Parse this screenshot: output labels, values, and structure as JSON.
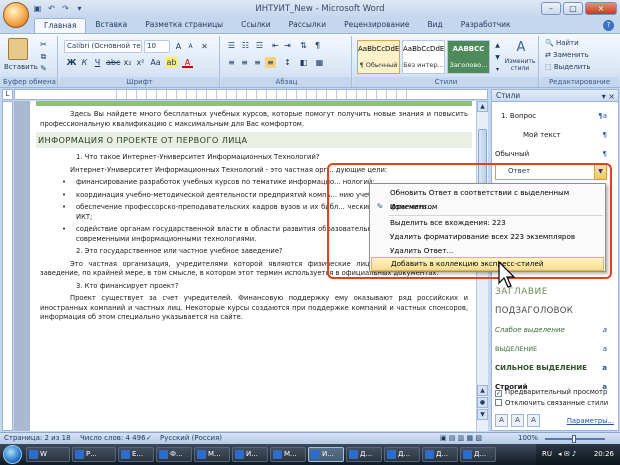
{
  "window": {
    "title": "ИНТУИТ_New - Microsoft Word",
    "controls": [
      "–",
      "□",
      "×"
    ]
  },
  "tabs": [
    "Главная",
    "Вставка",
    "Разметка страницы",
    "Ссылки",
    "Рассылки",
    "Рецензирование",
    "Вид",
    "Разработчик"
  ],
  "ribbon": {
    "clipboard": {
      "label": "Буфер обмена",
      "paste": "Вставить"
    },
    "font": {
      "label": "Шрифт",
      "name": "Calibri (Основной те",
      "size": "10",
      "bold": "Ж",
      "italic": "К",
      "underline": "Ч"
    },
    "paragraph": {
      "label": "Абзац"
    },
    "styles": {
      "label": "Стили",
      "items": [
        {
          "sample": "AaBbCcDdE",
          "name": "¶ Обычный"
        },
        {
          "sample": "AaBbCcDdE",
          "name": "Без интер..."
        },
        {
          "sample": "AABBCC",
          "name": "Заголово..."
        }
      ],
      "change_styles": "Изменить стили"
    },
    "editing": {
      "label": "Редактирование",
      "find": "Найти",
      "replace": "Заменить",
      "select": "Выделить"
    }
  },
  "document": {
    "intro": "Здесь Вы найдете много бесплатных учебных курсов, которые помогут получить новые знания и повысить профессиональную квалификацию  с максимальным для Вас комфортом.",
    "section_heading": "ИНФОРМАЦИЯ О ПРОЕКТЕ ОТ ПЕРВОГО ЛИЦА",
    "q1": "1.       Что такое Интернет-Университет Информационных Технологий?",
    "a1": "Интернет-Университет Информационных Технологий - это частная орг... дующие цели:",
    "bullets": [
      "финансирование разработок учебных курсов по тематике информацио... нологий;",
      "координация учебно-методической деятельности предприятий компь... нию учебных курсов по ИКТ;",
      "обеспечение профессорско-преподавательских кадров вузов и их библ... ческими материалами по курсам ИКТ;",
      "содействие органам государственной власти в области развития образовательных программ, связанных с современными информационными технологиями."
    ],
    "q2": "2.       Это государственное или частное учебное заведение?",
    "a2": "Это частная организация, учредителями которой являются физические лица. Это даже не учебное заведение, по крайней мере, в том смысле, в котором этот термин используется в официальных документах.",
    "q3": "3.       Кто финансирует проект?",
    "a3": "Проект существует за счет учредителей. Финансовую поддержку ему оказывают ряд российских и иностранных компаний и частных лиц. Некоторые курсы создаются при поддержке компаний и частных спонсоров, информация об этом специально указывается на сайте."
  },
  "styles_pane": {
    "title": "Стили",
    "items": [
      {
        "label": "1.  Вопрос",
        "mark": "¶a"
      },
      {
        "label": "Мой текст",
        "mark": "¶"
      },
      {
        "label": "Обычный",
        "mark": "¶"
      }
    ],
    "selected": "Ответ",
    "gallery": [
      {
        "label": "ЗАГЛАВИЕ",
        "mark": ""
      },
      {
        "label": "ПОДЗАГОЛОВОК",
        "mark": ""
      },
      {
        "label": "Слабое выделение",
        "mark": "a"
      },
      {
        "label": "ВЫДЕЛЕНИЕ",
        "mark": "a"
      },
      {
        "label": "СИЛЬНОЕ ВЫДЕЛЕНИЕ",
        "mark": "a"
      },
      {
        "label": "Строгий",
        "mark": "a"
      }
    ],
    "preview": "Предварительный просмотр",
    "disable_linked": "Отключить связанные стили",
    "params": "Параметры..."
  },
  "context_menu": {
    "items": [
      "Обновить Ответ в соответствии с выделенным фрагментом",
      "Изменить...",
      "Выделить все вхождения: 223",
      "Удалить форматирование всех 223 экземпляров",
      "Удалить Ответ...",
      "Добавить в коллекцию экспресс-стилей"
    ]
  },
  "status": {
    "page": "Страница: 2 из 18",
    "words": "Число слов: 4 496",
    "lang": "Русский (Россия)",
    "zoom": "100%"
  },
  "taskbar": {
    "items": [
      "W",
      "Р...",
      "Е...",
      "Ф...",
      "М...",
      "И...",
      "М...",
      "И...",
      "Д...",
      "Д...",
      "Д...",
      "Д..."
    ],
    "lang": "RU",
    "time": "20:26"
  }
}
